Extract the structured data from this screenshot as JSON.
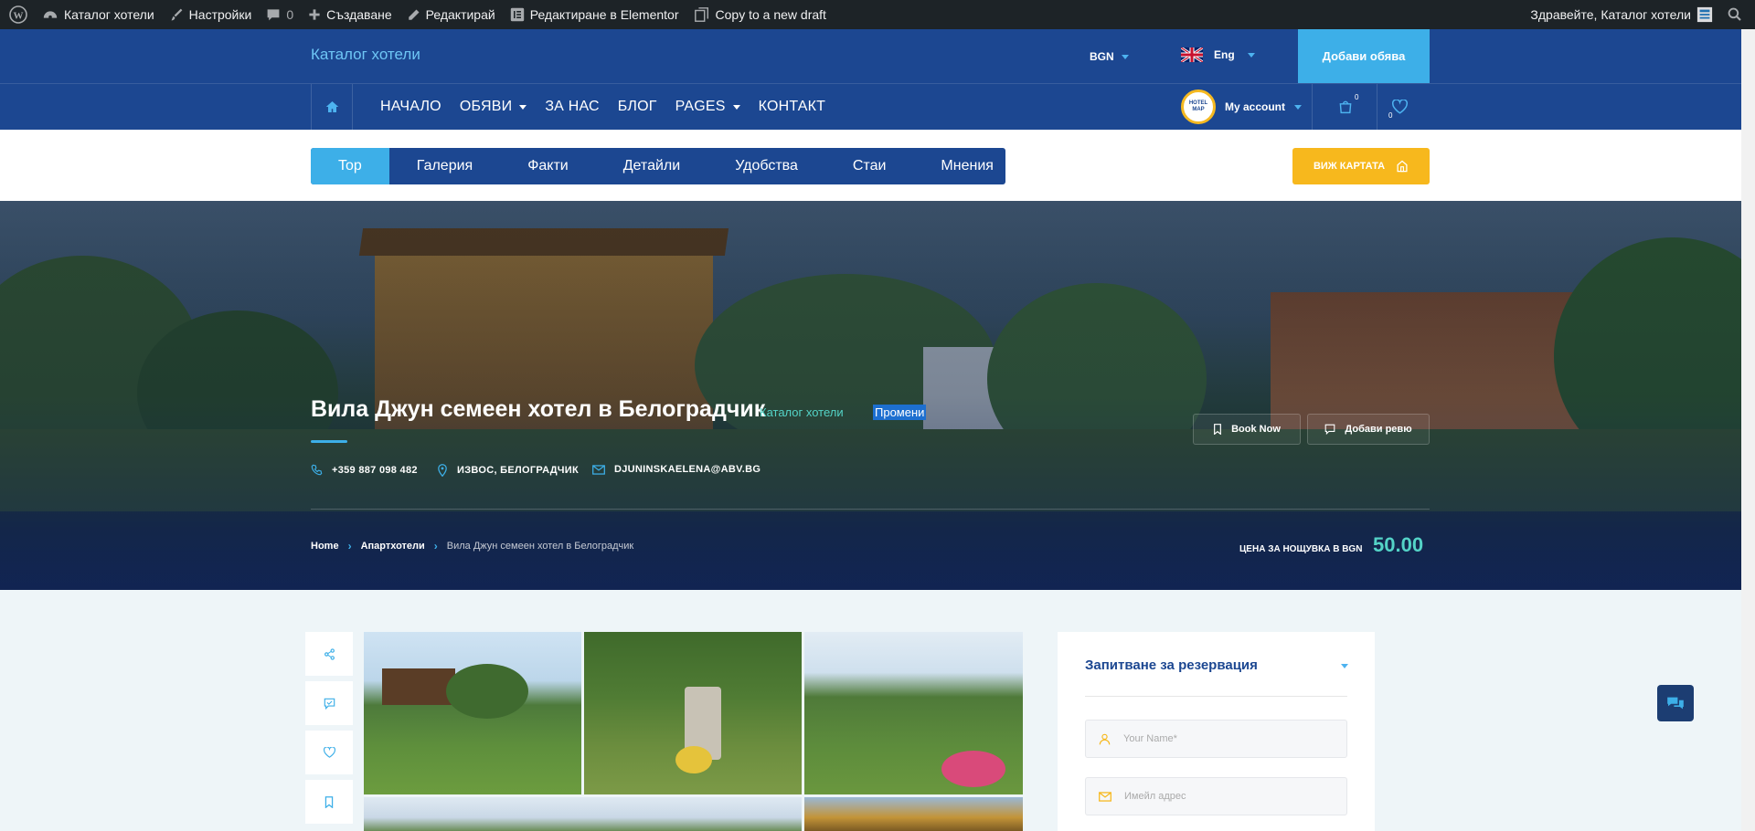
{
  "admin_bar": {
    "site_name": "Каталог хотели",
    "settings": "Настройки",
    "comments_count": "0",
    "create": "Създаване",
    "edit": "Редактирай",
    "edit_elementor": "Редактиране в Elementor",
    "copy_draft": "Copy to a new draft",
    "greeting": "Здравейте, Каталог хотели"
  },
  "header": {
    "site_title": "Каталог хотели",
    "currency": "BGN",
    "language": "Eng",
    "add_listing": "Добави обява"
  },
  "nav": {
    "items": [
      {
        "label": "НАЧАЛО",
        "dropdown": false
      },
      {
        "label": "ОБЯВИ",
        "dropdown": true
      },
      {
        "label": "ЗА НАС",
        "dropdown": false
      },
      {
        "label": "БЛОГ",
        "dropdown": false
      },
      {
        "label": "PAGES",
        "dropdown": true
      },
      {
        "label": "КОНТАКТ",
        "dropdown": false
      }
    ],
    "account": "My account",
    "cart_count": "0",
    "wishlist_count": "0",
    "logo_text": "HOTEL MAP"
  },
  "tabs": [
    "Top",
    "Галерия",
    "Факти",
    "Детайли",
    "Удобства",
    "Стаи",
    "Мнения"
  ],
  "map_button": "ВИЖ КАРТАТА",
  "hero": {
    "title": "Вила Джун семеен хотел в Белоградчик",
    "category": "Каталог хотели",
    "edit_link": "Промени",
    "phone": "+359 887 098 482",
    "location": "ИЗВОС, БЕЛОГРАДЧИК",
    "email": "DJUNINSKAELENA@ABV.BG",
    "book_now": "Book Now",
    "add_review": "Добави ревю",
    "breadcrumb": [
      "Home",
      "Апартхотели",
      "Вила Джун семеен хотел в Белоградчик"
    ],
    "price_label": "ЦЕНА ЗА НОЩУВКА В BGN",
    "price_value": "50.00"
  },
  "booking": {
    "title": "Запитване за резервация",
    "name_placeholder": "Your Name*",
    "email_placeholder": "Имейл адрес"
  },
  "colors": {
    "primary": "#1c4791",
    "accent": "#3dafe8",
    "yellow": "#f7b81d",
    "teal": "#54d3c7"
  }
}
